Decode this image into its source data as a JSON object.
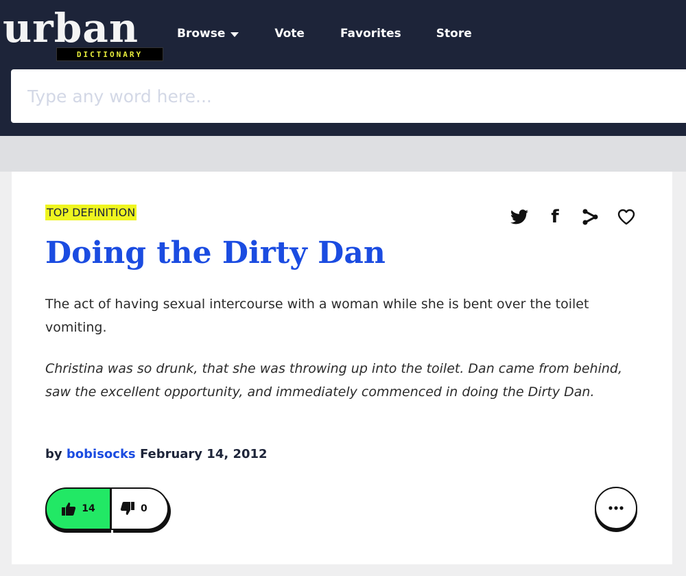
{
  "header": {
    "logo_word": "urban",
    "logo_tagline": "DICTIONARY",
    "nav": {
      "browse_label": "Browse",
      "vote_label": "Vote",
      "favorites_label": "Favorites",
      "store_label": "Store"
    },
    "search": {
      "placeholder": "Type any word here...",
      "value": ""
    }
  },
  "definition": {
    "badge": "TOP DEFINITION",
    "word": "Doing the Dirty Dan",
    "meaning": "The act of having sexual intercourse with a woman while she is bent over the toilet vomiting.",
    "example": "Christina was so drunk, that she was throwing up into the toilet. Dan came from behind, saw the excellent opportunity, and immediately commenced in doing the Dirty Dan.",
    "by_prefix": "by",
    "author": "bobisocks",
    "date": "February 14, 2012",
    "share_icons": [
      "twitter-icon",
      "facebook-icon",
      "share-icon",
      "heart-icon"
    ],
    "facebook_glyph": "f",
    "upvotes": "14",
    "downvotes": "0"
  },
  "colors": {
    "header_bg": "#1d2439",
    "word_link": "#1b4ce1",
    "badge_bg": "#eff51f",
    "upvote_bg": "#22e865"
  }
}
